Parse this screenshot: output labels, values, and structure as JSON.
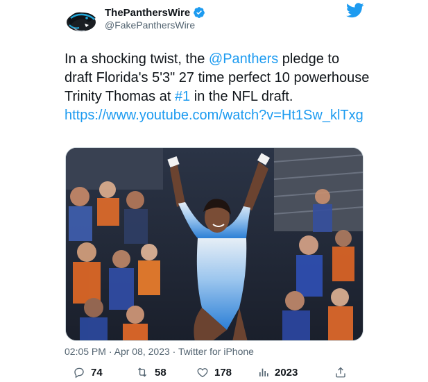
{
  "account": {
    "display_name": "ThePanthersWire",
    "handle": "@FakePanthersWire",
    "verified": true
  },
  "tweet": {
    "segments": [
      {
        "text": "In a shocking twist, the ",
        "type": "text"
      },
      {
        "text": "@Panthers",
        "type": "mention"
      },
      {
        "text": " pledge to draft Florida's 5'3\" 27 time perfect 10 powerhouse Trinity Thomas at ",
        "type": "text"
      },
      {
        "text": "#1",
        "type": "hashtag"
      },
      {
        "text": " in the NFL draft. ",
        "type": "text"
      },
      {
        "text": "https://www.youtube.com/watch?v=Ht1Sw_klTxg",
        "type": "url"
      }
    ]
  },
  "meta": {
    "time": "02:05 PM",
    "date": "Apr 08, 2023",
    "source": "Twitter for iPhone",
    "separator": " · "
  },
  "actions": {
    "replies": "74",
    "retweets": "58",
    "likes": "178",
    "views": "2023"
  },
  "colors": {
    "link": "#1d9bf0",
    "secondary_text": "#536471",
    "verified_badge": "#1d9bf0",
    "twitter_bird": "#1d9bf0"
  },
  "icons": [
    "panther-logo-icon",
    "verified-badge-icon",
    "twitter-bird-icon",
    "reply-icon",
    "retweet-icon",
    "like-icon",
    "views-icon",
    "share-icon"
  ]
}
